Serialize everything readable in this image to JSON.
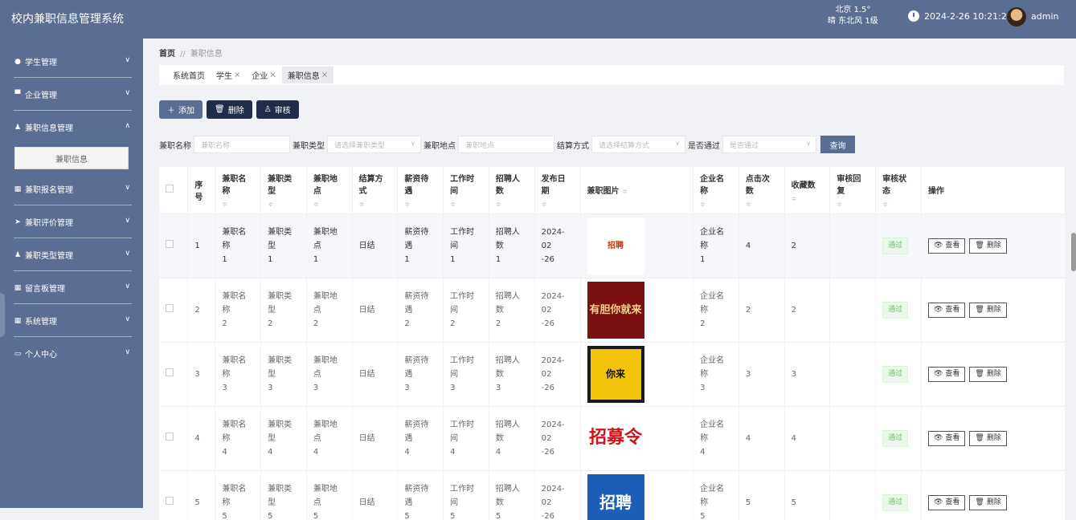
{
  "header": {
    "app_title": "校内兼职信息管理系统",
    "weather_line1": "北京 1.5°",
    "weather_line2": "晴 东北风 1级",
    "datetime": "2024-2-26 10:21:23",
    "username": "admin"
  },
  "sidebar": {
    "items": [
      {
        "label": "学生管理",
        "icon": "bulb-icon",
        "chevron": "∨"
      },
      {
        "label": "企业管理",
        "icon": "chat-icon",
        "chevron": "∨"
      },
      {
        "label": "兼职信息管理",
        "icon": "user-icon",
        "chevron": "∧"
      },
      {
        "label": "兼职报名管理",
        "icon": "grid-icon",
        "chevron": "∨"
      },
      {
        "label": "兼职评价管理",
        "icon": "send-icon",
        "chevron": "∨"
      },
      {
        "label": "兼职类型管理",
        "icon": "user-icon",
        "chevron": "∨"
      },
      {
        "label": "留言板管理",
        "icon": "grid-icon",
        "chevron": "∨"
      },
      {
        "label": "系统管理",
        "icon": "grid-icon",
        "chevron": "∨"
      },
      {
        "label": "个人中心",
        "icon": "calendar-icon",
        "chevron": "∨"
      }
    ],
    "submenu_label": "兼职信息"
  },
  "breadcrumb": {
    "home": "首页",
    "sep": "//",
    "current": "兼职信息"
  },
  "tabs": [
    {
      "label": "系统首页",
      "close": ""
    },
    {
      "label": "学生",
      "close": "×"
    },
    {
      "label": "企业",
      "close": "×"
    },
    {
      "label": "兼职信息",
      "close": "×"
    }
  ],
  "toolbar": {
    "add": "添加",
    "delete": "删除",
    "audit": "审核"
  },
  "filters": {
    "name_label": "兼职名称",
    "name_placeholder": "兼职名称",
    "type_label": "兼职类型",
    "type_placeholder": "请选择兼职类型",
    "place_label": "兼职地点",
    "place_placeholder": "兼职地点",
    "settle_label": "结算方式",
    "settle_placeholder": "请选择结算方式",
    "pass_label": "是否通过",
    "pass_placeholder": "是否通过",
    "query": "查询"
  },
  "table": {
    "sort_glyph": "≑",
    "headers": [
      "序号",
      "兼职名称",
      "兼职类型",
      "兼职地点",
      "结算方式",
      "薪资待遇",
      "工作时间",
      "招聘人数",
      "发布日期",
      "兼职图片",
      "企业名称",
      "点击次数",
      "收藏数",
      "审核回复",
      "审核状态",
      "操作"
    ],
    "rows": [
      {
        "no": "1",
        "name": "兼职名称\n1",
        "type": "兼职类型\n1",
        "place": "兼职地点\n1",
        "settle": "日结",
        "salary": "薪资待遇\n1",
        "time": "工作时间\n1",
        "count": "招聘人数\n1",
        "date": "2024-02\n-26",
        "pic": "招聘",
        "company": "企业名称\n1",
        "clicks": "4",
        "favs": "2",
        "reply": "",
        "status": "通过"
      },
      {
        "no": "2",
        "name": "兼职名称\n2",
        "type": "兼职类型\n2",
        "place": "兼职地点\n2",
        "settle": "日结",
        "salary": "薪资待遇\n2",
        "time": "工作时间\n2",
        "count": "招聘人数\n2",
        "date": "2024-02\n-26",
        "pic": "有胆你就来",
        "company": "企业名称\n2",
        "clicks": "2",
        "favs": "2",
        "reply": "",
        "status": "通过"
      },
      {
        "no": "3",
        "name": "兼职名称\n3",
        "type": "兼职类型\n3",
        "place": "兼职地点\n3",
        "settle": "日结",
        "salary": "薪资待遇\n3",
        "time": "工作时间\n3",
        "count": "招聘人数\n3",
        "date": "2024-02\n-26",
        "pic": "你来",
        "company": "企业名称\n3",
        "clicks": "3",
        "favs": "3",
        "reply": "",
        "status": "通过"
      },
      {
        "no": "4",
        "name": "兼职名称\n4",
        "type": "兼职类型\n4",
        "place": "兼职地点\n4",
        "settle": "日结",
        "salary": "薪资待遇\n4",
        "time": "工作时间\n4",
        "count": "招聘人数\n4",
        "date": "2024-02\n-26",
        "pic": "招募令",
        "company": "企业名称\n4",
        "clicks": "4",
        "favs": "4",
        "reply": "",
        "status": "通过"
      },
      {
        "no": "5",
        "name": "兼职名称\n5",
        "type": "兼职类型\n5",
        "place": "兼职地点\n5",
        "settle": "日结",
        "salary": "薪资待遇\n5",
        "time": "工作时间\n5",
        "count": "招聘人数\n5",
        "date": "2024-02\n-26",
        "pic": "招聘",
        "company": "企业名称\n5",
        "clicks": "5",
        "favs": "5",
        "reply": "",
        "status": "通过"
      }
    ],
    "view_label": "查看",
    "delete_label": "删除"
  }
}
